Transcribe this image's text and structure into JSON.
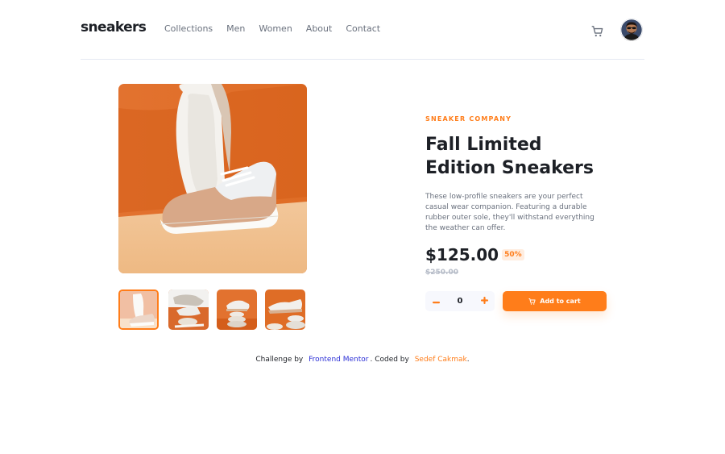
{
  "header": {
    "logo": "sneakers",
    "nav": [
      "Collections",
      "Men",
      "Women",
      "About",
      "Contact"
    ]
  },
  "product": {
    "company": "SNEAKER COMPANY",
    "name": "Fall Limited Edition Sneakers",
    "description": "These low-profile sneakers are your perfect casual wear companion. Featuring a durable rubber outer sole, they'll withstand everything the weather can offer.",
    "price": "$125.00",
    "discount": "50%",
    "old_price": "$250.00",
    "quantity": "0",
    "add_to_cart_label": "Add to cart"
  },
  "footer": {
    "prefix": "Challenge by",
    "org": "Frontend Mentor",
    "middle": ". Coded by",
    "author": "Sedef Cakmak",
    "suffix": "."
  },
  "colors": {
    "accent": "#ff7d1a",
    "dark": "#1d2026",
    "muted": "#69707d"
  },
  "icons": [
    "cart-icon",
    "avatar",
    "minus-icon",
    "plus-icon"
  ]
}
